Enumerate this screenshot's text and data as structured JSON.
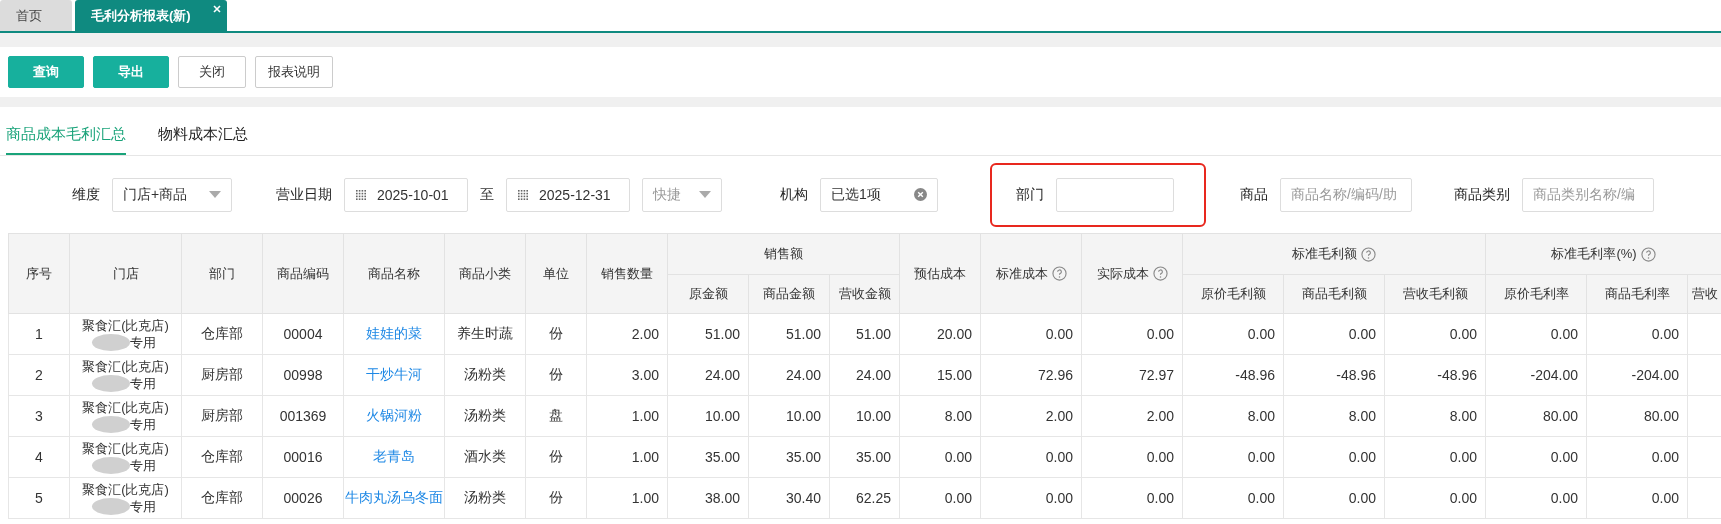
{
  "tabs": [
    {
      "label": "首页",
      "selected": false,
      "closable": false
    },
    {
      "label": "毛利分析报表(新)",
      "selected": true,
      "closable": true
    }
  ],
  "toolbar": [
    {
      "label": "查询",
      "kind": "primary"
    },
    {
      "label": "导出",
      "kind": "primary"
    },
    {
      "label": "关闭",
      "kind": "default"
    },
    {
      "label": "报表说明",
      "kind": "default"
    }
  ],
  "subtabs": [
    {
      "label": "商品成本毛利汇总",
      "selected": true
    },
    {
      "label": "物料成本汇总",
      "selected": false
    }
  ],
  "filters": [
    {
      "kind": "select",
      "label": "维度",
      "value": "门店+商品",
      "highlighted": false
    },
    {
      "kind": "daterange",
      "label": "营业日期",
      "start": "2025-10-01",
      "separator": "至",
      "end": "2025-12-31",
      "quick": "快捷",
      "highlighted": false
    },
    {
      "kind": "multi",
      "label": "机构",
      "value": "已选1项",
      "highlighted": false
    },
    {
      "kind": "text",
      "label": "部门",
      "highlighted": true
    },
    {
      "kind": "text",
      "label": "商品",
      "placeholder": "商品名称/编码/助",
      "highlighted": false
    },
    {
      "kind": "text",
      "label": "商品类别",
      "placeholder": "商品类别名称/编",
      "highlighted": false
    }
  ],
  "table": {
    "columns": [
      {
        "title": "序号",
        "help": false
      },
      {
        "title": "门店",
        "help": false
      },
      {
        "title": "部门",
        "help": false
      },
      {
        "title": "商品编码",
        "help": false
      },
      {
        "title": "商品名称",
        "help": false
      },
      {
        "title": "商品小类",
        "help": false
      },
      {
        "title": "单位",
        "help": false
      },
      {
        "title": "销售数量",
        "help": false
      },
      {
        "title": "销售额",
        "help": false,
        "children": [
          {
            "title": "原金额"
          },
          {
            "title": "商品金额"
          },
          {
            "title": "营收金额"
          }
        ]
      },
      {
        "title": "预估成本",
        "help": false
      },
      {
        "title": "标准成本",
        "help": true
      },
      {
        "title": "实际成本",
        "help": true
      },
      {
        "title": "标准毛利额",
        "help": true,
        "children": [
          {
            "title": "原价毛利额"
          },
          {
            "title": "商品毛利额"
          },
          {
            "title": "营收毛利额"
          }
        ]
      },
      {
        "title": "标准毛利率(%)",
        "help": true,
        "children": [
          {
            "title": "原价毛利率"
          },
          {
            "title": "商品毛利率"
          },
          {
            "title": "营收"
          }
        ]
      }
    ],
    "rows": [
      {
        "no": "1",
        "store": "聚食汇(比克店)",
        "store_note": "专用",
        "department": "仓库部",
        "code": "00004",
        "product": "娃娃的菜",
        "category": "养生时蔬",
        "unit": "份",
        "values": [
          "2.00",
          "51.00",
          "51.00",
          "51.00",
          "20.00",
          "0.00",
          "0.00",
          "0.00",
          "0.00",
          "0.00",
          "0.00",
          "0.00"
        ]
      },
      {
        "no": "2",
        "store": "聚食汇(比克店)",
        "store_note": "专用",
        "department": "厨房部",
        "code": "00998",
        "product": "干炒牛河",
        "category": "汤粉类",
        "unit": "份",
        "values": [
          "3.00",
          "24.00",
          "24.00",
          "24.00",
          "15.00",
          "72.96",
          "72.97",
          "-48.96",
          "-48.96",
          "-48.96",
          "-204.00",
          "-204.00"
        ]
      },
      {
        "no": "3",
        "store": "聚食汇(比克店)",
        "store_note": "专用",
        "department": "厨房部",
        "code": "001369",
        "product": "火锅河粉",
        "category": "汤粉类",
        "unit": "盘",
        "values": [
          "1.00",
          "10.00",
          "10.00",
          "10.00",
          "8.00",
          "2.00",
          "2.00",
          "8.00",
          "8.00",
          "8.00",
          "80.00",
          "80.00"
        ]
      },
      {
        "no": "4",
        "store": "聚食汇(比克店)",
        "store_note": "专用",
        "department": "仓库部",
        "code": "00016",
        "product": "老青岛",
        "category": "酒水类",
        "unit": "份",
        "values": [
          "1.00",
          "35.00",
          "35.00",
          "35.00",
          "0.00",
          "0.00",
          "0.00",
          "0.00",
          "0.00",
          "0.00",
          "0.00",
          "0.00"
        ]
      },
      {
        "no": "5",
        "store": "聚食汇(比克店)",
        "store_note": "专用",
        "department": "仓库部",
        "code": "00026",
        "product": "牛肉丸汤乌冬面",
        "category": "汤粉类",
        "unit": "份",
        "values": [
          "1.00",
          "38.00",
          "30.40",
          "62.25",
          "0.00",
          "0.00",
          "0.00",
          "0.00",
          "0.00",
          "0.00",
          "0.00",
          "0.00"
        ]
      }
    ]
  }
}
